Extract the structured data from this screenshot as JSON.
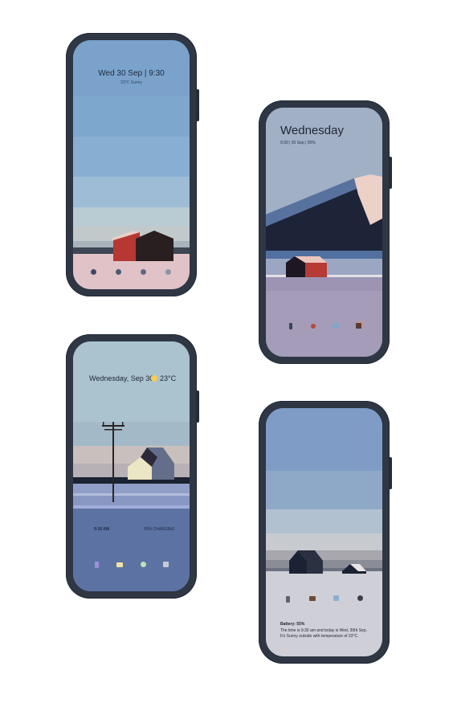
{
  "phones": [
    {
      "id": 1,
      "clock_line": "Wed 30 Sep  |  9:30",
      "weather_line": "23°C  Sunny",
      "dock_icons": [
        "dock-app-1",
        "dock-app-2",
        "dock-app-3",
        "dock-app-4"
      ]
    },
    {
      "id": 2,
      "day": "Wednesday",
      "info_line": "9:30    |    30 Sep    |    55%",
      "dock_icons": [
        "phone-icon",
        "camera-icon",
        "messages-icon",
        "gallery-icon"
      ]
    },
    {
      "id": 3,
      "date_line": "Wednesday, Sep 30",
      "temperature": "23°C",
      "time_small": "9:30 AM",
      "battery_small": "55% CHARGING",
      "dock_icons": [
        "phone-icon",
        "mail-icon",
        "chrome-icon",
        "camera-icon"
      ]
    },
    {
      "id": 4,
      "battery_heading": "Battery: 55%",
      "summary_line_1": "The time is 9:30 am and today is Wed, 30th Sep.",
      "summary_line_2": "It's Sunny outside with temperature of 23°C.",
      "dock_icons": [
        "phone-icon",
        "messages-icon",
        "cube-icon",
        "camera-icon"
      ]
    }
  ]
}
